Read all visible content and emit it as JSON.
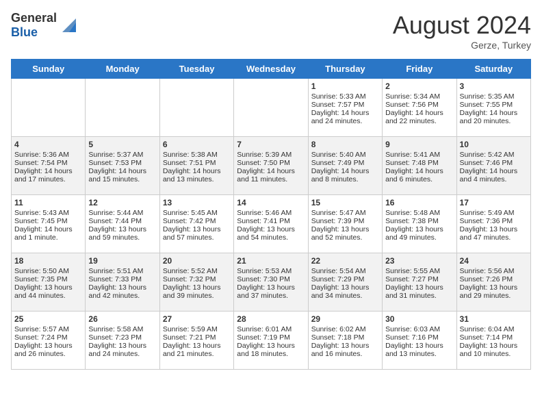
{
  "header": {
    "logo_general": "General",
    "logo_blue": "Blue",
    "month_year": "August 2024",
    "location": "Gerze, Turkey"
  },
  "weekdays": [
    "Sunday",
    "Monday",
    "Tuesday",
    "Wednesday",
    "Thursday",
    "Friday",
    "Saturday"
  ],
  "weeks": [
    [
      {
        "day": "",
        "content": ""
      },
      {
        "day": "",
        "content": ""
      },
      {
        "day": "",
        "content": ""
      },
      {
        "day": "",
        "content": ""
      },
      {
        "day": "1",
        "content": "Sunrise: 5:33 AM\nSunset: 7:57 PM\nDaylight: 14 hours and 24 minutes."
      },
      {
        "day": "2",
        "content": "Sunrise: 5:34 AM\nSunset: 7:56 PM\nDaylight: 14 hours and 22 minutes."
      },
      {
        "day": "3",
        "content": "Sunrise: 5:35 AM\nSunset: 7:55 PM\nDaylight: 14 hours and 20 minutes."
      }
    ],
    [
      {
        "day": "4",
        "content": "Sunrise: 5:36 AM\nSunset: 7:54 PM\nDaylight: 14 hours and 17 minutes."
      },
      {
        "day": "5",
        "content": "Sunrise: 5:37 AM\nSunset: 7:53 PM\nDaylight: 14 hours and 15 minutes."
      },
      {
        "day": "6",
        "content": "Sunrise: 5:38 AM\nSunset: 7:51 PM\nDaylight: 14 hours and 13 minutes."
      },
      {
        "day": "7",
        "content": "Sunrise: 5:39 AM\nSunset: 7:50 PM\nDaylight: 14 hours and 11 minutes."
      },
      {
        "day": "8",
        "content": "Sunrise: 5:40 AM\nSunset: 7:49 PM\nDaylight: 14 hours and 8 minutes."
      },
      {
        "day": "9",
        "content": "Sunrise: 5:41 AM\nSunset: 7:48 PM\nDaylight: 14 hours and 6 minutes."
      },
      {
        "day": "10",
        "content": "Sunrise: 5:42 AM\nSunset: 7:46 PM\nDaylight: 14 hours and 4 minutes."
      }
    ],
    [
      {
        "day": "11",
        "content": "Sunrise: 5:43 AM\nSunset: 7:45 PM\nDaylight: 14 hours and 1 minute."
      },
      {
        "day": "12",
        "content": "Sunrise: 5:44 AM\nSunset: 7:44 PM\nDaylight: 13 hours and 59 minutes."
      },
      {
        "day": "13",
        "content": "Sunrise: 5:45 AM\nSunset: 7:42 PM\nDaylight: 13 hours and 57 minutes."
      },
      {
        "day": "14",
        "content": "Sunrise: 5:46 AM\nSunset: 7:41 PM\nDaylight: 13 hours and 54 minutes."
      },
      {
        "day": "15",
        "content": "Sunrise: 5:47 AM\nSunset: 7:39 PM\nDaylight: 13 hours and 52 minutes."
      },
      {
        "day": "16",
        "content": "Sunrise: 5:48 AM\nSunset: 7:38 PM\nDaylight: 13 hours and 49 minutes."
      },
      {
        "day": "17",
        "content": "Sunrise: 5:49 AM\nSunset: 7:36 PM\nDaylight: 13 hours and 47 minutes."
      }
    ],
    [
      {
        "day": "18",
        "content": "Sunrise: 5:50 AM\nSunset: 7:35 PM\nDaylight: 13 hours and 44 minutes."
      },
      {
        "day": "19",
        "content": "Sunrise: 5:51 AM\nSunset: 7:33 PM\nDaylight: 13 hours and 42 minutes."
      },
      {
        "day": "20",
        "content": "Sunrise: 5:52 AM\nSunset: 7:32 PM\nDaylight: 13 hours and 39 minutes."
      },
      {
        "day": "21",
        "content": "Sunrise: 5:53 AM\nSunset: 7:30 PM\nDaylight: 13 hours and 37 minutes."
      },
      {
        "day": "22",
        "content": "Sunrise: 5:54 AM\nSunset: 7:29 PM\nDaylight: 13 hours and 34 minutes."
      },
      {
        "day": "23",
        "content": "Sunrise: 5:55 AM\nSunset: 7:27 PM\nDaylight: 13 hours and 31 minutes."
      },
      {
        "day": "24",
        "content": "Sunrise: 5:56 AM\nSunset: 7:26 PM\nDaylight: 13 hours and 29 minutes."
      }
    ],
    [
      {
        "day": "25",
        "content": "Sunrise: 5:57 AM\nSunset: 7:24 PM\nDaylight: 13 hours and 26 minutes."
      },
      {
        "day": "26",
        "content": "Sunrise: 5:58 AM\nSunset: 7:23 PM\nDaylight: 13 hours and 24 minutes."
      },
      {
        "day": "27",
        "content": "Sunrise: 5:59 AM\nSunset: 7:21 PM\nDaylight: 13 hours and 21 minutes."
      },
      {
        "day": "28",
        "content": "Sunrise: 6:01 AM\nSunset: 7:19 PM\nDaylight: 13 hours and 18 minutes."
      },
      {
        "day": "29",
        "content": "Sunrise: 6:02 AM\nSunset: 7:18 PM\nDaylight: 13 hours and 16 minutes."
      },
      {
        "day": "30",
        "content": "Sunrise: 6:03 AM\nSunset: 7:16 PM\nDaylight: 13 hours and 13 minutes."
      },
      {
        "day": "31",
        "content": "Sunrise: 6:04 AM\nSunset: 7:14 PM\nDaylight: 13 hours and 10 minutes."
      }
    ]
  ]
}
